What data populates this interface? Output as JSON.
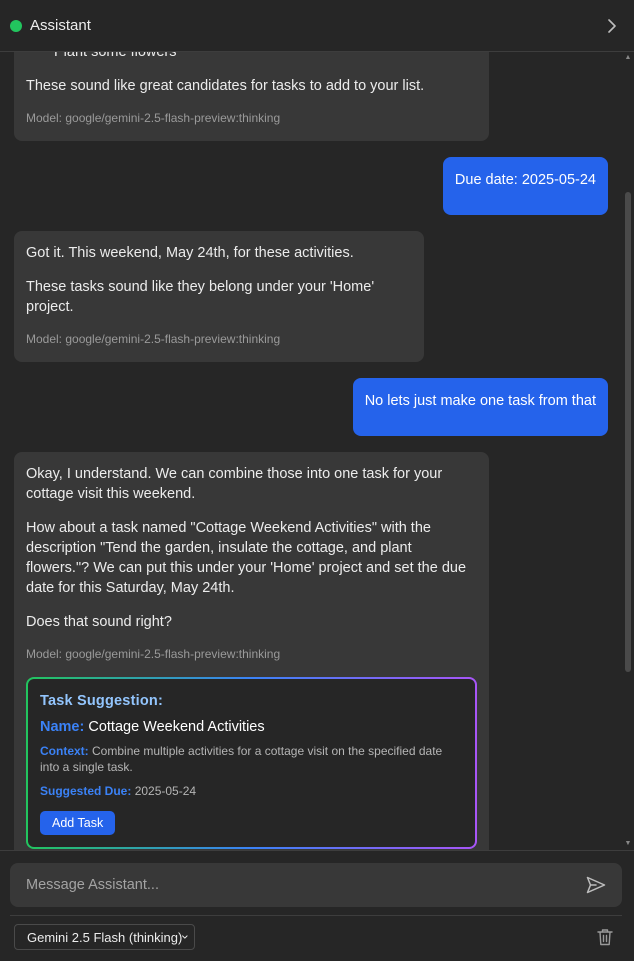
{
  "header": {
    "title": "Assistant",
    "status_color": "#22c55e",
    "collapse_icon": "chevron-right-icon"
  },
  "messages": [
    {
      "role": "assistant",
      "list_items": [
        "Plant some flowers"
      ],
      "paragraphs": [
        "These sound like great candidates for tasks to add to your list."
      ],
      "model": "Model: google/gemini-2.5-flash-preview:thinking"
    },
    {
      "role": "user",
      "text": "Due date: 2025-05-24"
    },
    {
      "role": "assistant",
      "paragraphs": [
        "Got it. This weekend, May 24th, for these activities.",
        "These tasks sound like they belong under your 'Home' project."
      ],
      "model": "Model: google/gemini-2.5-flash-preview:thinking"
    },
    {
      "role": "user",
      "text": "No lets just make one task from that"
    },
    {
      "role": "assistant",
      "paragraphs": [
        "Okay, I understand. We can combine those into one task for your cottage visit this weekend.",
        "How about a task named \"Cottage Weekend Activities\" with the description \"Tend the garden, insulate the cottage, and plant flowers.\"? We can put this under your 'Home' project and set the due date for this Saturday, May 24th.",
        "Does that sound right?"
      ],
      "model": "Model: google/gemini-2.5-flash-preview:thinking",
      "task_suggestion": {
        "heading": "Task Suggestion:",
        "name_label": "Name:",
        "name": "Cottage Weekend Activities",
        "context_label": "Context:",
        "context": "Combine multiple activities for a cottage visit on the specified date into a single task.",
        "due_label": "Suggested Due:",
        "due": "2025-05-24",
        "button_label": "Add Task"
      }
    }
  ],
  "composer": {
    "placeholder": "Message Assistant...",
    "send_icon": "send-icon"
  },
  "footer": {
    "model_selected": "Gemini 2.5 Flash (thinking)",
    "delete_icon": "trash-icon"
  },
  "colors": {
    "accent": "#2563eb",
    "background": "#262626",
    "bubble": "#383838"
  }
}
